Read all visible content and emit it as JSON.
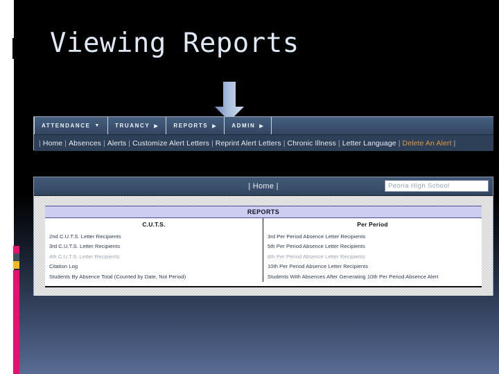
{
  "slide": {
    "title": "Viewing Reports"
  },
  "arrow": {
    "name": "down-arrow-pointer",
    "color": "#8da5cf",
    "points_to": "REPORTS"
  },
  "nav_panel": {
    "menu": [
      {
        "label": "ATTENDANCE",
        "marker": "▼"
      },
      {
        "label": "TRUANCY",
        "marker": "▶"
      },
      {
        "label": "REPORTS",
        "marker": "▶"
      },
      {
        "label": "ADMIN",
        "marker": "▶"
      }
    ],
    "submenu": {
      "leading_separator": "|",
      "items": [
        {
          "label": "Home",
          "highlight": false
        },
        {
          "label": "Absences",
          "highlight": false
        },
        {
          "label": "Alerts",
          "highlight": false
        },
        {
          "label": "Customize Alert Letters",
          "highlight": false
        },
        {
          "label": "Reprint Alert Letters",
          "highlight": false
        },
        {
          "label": "Chronic Illness",
          "highlight": false
        },
        {
          "label": "Letter Language",
          "highlight": false
        },
        {
          "label": "Delete An Alert",
          "highlight": true
        }
      ],
      "separator": "|",
      "highlight_color": "#e09b3d"
    }
  },
  "app_panel": {
    "topbar": {
      "home_link": "|  Home  |",
      "school_select_value": "Peoria High School"
    },
    "reports": {
      "title": "REPORTS",
      "columns": [
        {
          "header": "C.U.T.S.",
          "items": [
            {
              "label": "2nd C.U.T.S. Letter Recipients",
              "faded": false
            },
            {
              "label": "3rd C.U.T.S. Letter Recipients",
              "faded": false
            },
            {
              "label": "4th C.U.T.S. Letter Recipients",
              "faded": true
            },
            {
              "label": "Citation Log",
              "faded": false
            },
            {
              "label": "Students By Absence Total (Counted by Date, Not Period)",
              "faded": false
            }
          ]
        },
        {
          "header": "Per Period",
          "items": [
            {
              "label": "3rd Per Period Absence Letter Recipients",
              "faded": false
            },
            {
              "label": "5th Per Period Absence Letter Recipients",
              "faded": false
            },
            {
              "label": "8th Per Period Absence Letter Recipients",
              "faded": true
            },
            {
              "label": "10th Per Period Absence Letter Recipients",
              "faded": false
            },
            {
              "label": "Students With Absences After Generating 10th Per Period Absence Alert",
              "faded": false
            }
          ]
        }
      ]
    }
  }
}
